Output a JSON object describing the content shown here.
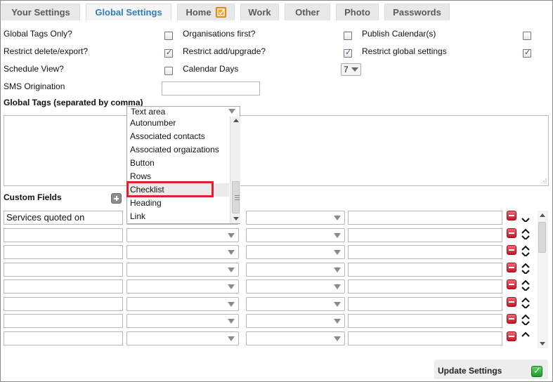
{
  "tabs": [
    {
      "label": "Your Settings",
      "active": false
    },
    {
      "label": "Global Settings",
      "active": true
    },
    {
      "label": "Home",
      "active": false,
      "icon": "edit-badge-icon"
    },
    {
      "label": "Work",
      "active": false
    },
    {
      "label": "Other",
      "active": false
    },
    {
      "label": "Photo",
      "active": false
    },
    {
      "label": "Passwords",
      "active": false
    }
  ],
  "settings": {
    "global_tags_only": {
      "label": "Global Tags Only?",
      "checked": false
    },
    "organisations_first": {
      "label": "Organisations first?",
      "checked": false
    },
    "publish_calendars": {
      "label": "Publish Calendar(s)",
      "checked": false
    },
    "restrict_delete_export": {
      "label": "Restrict delete/export?",
      "checked": true
    },
    "restrict_add_upgrade": {
      "label": "Restrict add/upgrade?",
      "checked": true
    },
    "restrict_global_settings": {
      "label": "Restrict global settings",
      "checked": true
    },
    "schedule_view": {
      "label": "Schedule View?",
      "checked": false
    },
    "calendar_days": {
      "label": "Calendar Days",
      "value": "7"
    },
    "sms_origination": {
      "label": "SMS Origination",
      "value": ""
    }
  },
  "global_tags": {
    "label": "Global Tags (separated by comma)",
    "value": ""
  },
  "custom_fields": {
    "label": "Custom Fields",
    "rows": [
      {
        "name": "Services quoted on",
        "type": "",
        "option": "",
        "extra": ""
      },
      {
        "name": "",
        "type": "",
        "option": "",
        "extra": ""
      },
      {
        "name": "",
        "type": "",
        "option": "",
        "extra": ""
      },
      {
        "name": "",
        "type": "",
        "option": "",
        "extra": ""
      },
      {
        "name": "",
        "type": "",
        "option": "",
        "extra": ""
      },
      {
        "name": "",
        "type": "",
        "option": "",
        "extra": ""
      },
      {
        "name": "",
        "type": "",
        "option": "",
        "extra": ""
      },
      {
        "name": "",
        "type": "",
        "option": "",
        "extra": ""
      }
    ]
  },
  "type_dropdown": {
    "current": "Text area",
    "options": [
      "Autonumber",
      "Associated contacts",
      "Associated orgaizations",
      "Button",
      "Rows",
      "Checklist",
      "Heading",
      "Link"
    ],
    "highlighted": "Checklist"
  },
  "update_button": {
    "label": "Update Settings"
  },
  "colors": {
    "active_tab": "#2f7fb9",
    "highlight_box": "#e0202a",
    "remove_button": "#c8152a",
    "update_icon": "#1f9a2a"
  }
}
